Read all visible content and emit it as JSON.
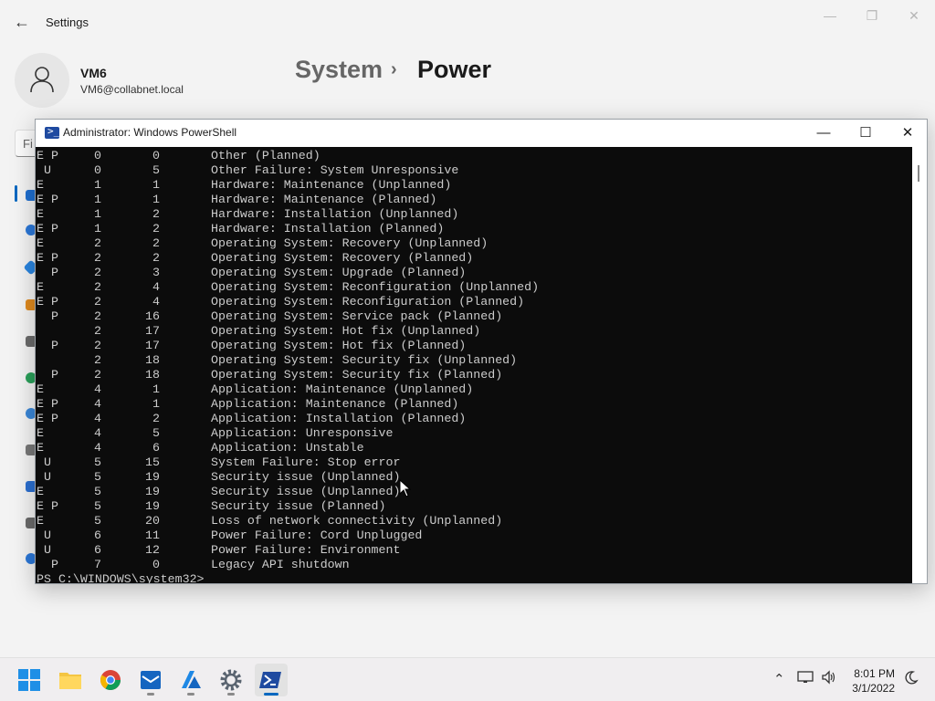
{
  "settings": {
    "app_title": "Settings",
    "user_name": "VM6",
    "user_email": "VM6@collabnet.local",
    "breadcrumb_parent": "System",
    "breadcrumb_separator": "›",
    "breadcrumb_current": "Power",
    "search_placeholder": "Fi"
  },
  "powershell": {
    "title": "Administrator: Windows PowerShell",
    "rows": [
      {
        "flags": "E P",
        "major": "0",
        "minor": "0",
        "desc": "Other (Planned)"
      },
      {
        "flags": " U",
        "major": "0",
        "minor": "5",
        "desc": "Other Failure: System Unresponsive"
      },
      {
        "flags": "E",
        "major": "1",
        "minor": "1",
        "desc": "Hardware: Maintenance (Unplanned)"
      },
      {
        "flags": "E P",
        "major": "1",
        "minor": "1",
        "desc": "Hardware: Maintenance (Planned)"
      },
      {
        "flags": "E",
        "major": "1",
        "minor": "2",
        "desc": "Hardware: Installation (Unplanned)"
      },
      {
        "flags": "E P",
        "major": "1",
        "minor": "2",
        "desc": "Hardware: Installation (Planned)"
      },
      {
        "flags": "E",
        "major": "2",
        "minor": "2",
        "desc": "Operating System: Recovery (Unplanned)"
      },
      {
        "flags": "E P",
        "major": "2",
        "minor": "2",
        "desc": "Operating System: Recovery (Planned)"
      },
      {
        "flags": "  P",
        "major": "2",
        "minor": "3",
        "desc": "Operating System: Upgrade (Planned)"
      },
      {
        "flags": "E",
        "major": "2",
        "minor": "4",
        "desc": "Operating System: Reconfiguration (Unplanned)"
      },
      {
        "flags": "E P",
        "major": "2",
        "minor": "4",
        "desc": "Operating System: Reconfiguration (Planned)"
      },
      {
        "flags": "  P",
        "major": "2",
        "minor": "16",
        "desc": "Operating System: Service pack (Planned)"
      },
      {
        "flags": "",
        "major": "2",
        "minor": "17",
        "desc": "Operating System: Hot fix (Unplanned)"
      },
      {
        "flags": "  P",
        "major": "2",
        "minor": "17",
        "desc": "Operating System: Hot fix (Planned)"
      },
      {
        "flags": "",
        "major": "2",
        "minor": "18",
        "desc": "Operating System: Security fix (Unplanned)"
      },
      {
        "flags": "  P",
        "major": "2",
        "minor": "18",
        "desc": "Operating System: Security fix (Planned)"
      },
      {
        "flags": "E",
        "major": "4",
        "minor": "1",
        "desc": "Application: Maintenance (Unplanned)"
      },
      {
        "flags": "E P",
        "major": "4",
        "minor": "1",
        "desc": "Application: Maintenance (Planned)"
      },
      {
        "flags": "E P",
        "major": "4",
        "minor": "2",
        "desc": "Application: Installation (Planned)"
      },
      {
        "flags": "E",
        "major": "4",
        "minor": "5",
        "desc": "Application: Unresponsive"
      },
      {
        "flags": "E",
        "major": "4",
        "minor": "6",
        "desc": "Application: Unstable"
      },
      {
        "flags": " U",
        "major": "5",
        "minor": "15",
        "desc": "System Failure: Stop error"
      },
      {
        "flags": " U",
        "major": "5",
        "minor": "19",
        "desc": "Security issue (Unplanned)"
      },
      {
        "flags": "E",
        "major": "5",
        "minor": "19",
        "desc": "Security issue (Unplanned)"
      },
      {
        "flags": "E P",
        "major": "5",
        "minor": "19",
        "desc": "Security issue (Planned)"
      },
      {
        "flags": "E",
        "major": "5",
        "minor": "20",
        "desc": "Loss of network connectivity (Unplanned)"
      },
      {
        "flags": " U",
        "major": "6",
        "minor": "11",
        "desc": "Power Failure: Cord Unplugged"
      },
      {
        "flags": " U",
        "major": "6",
        "minor": "12",
        "desc": "Power Failure: Environment"
      },
      {
        "flags": "  P",
        "major": "7",
        "minor": "0",
        "desc": "Legacy API shutdown"
      }
    ],
    "prompt": "PS C:\\WINDOWS\\system32>"
  },
  "taskbar": {
    "time": "8:01 PM",
    "date": "3/1/2022",
    "apps": [
      "start-icon",
      "file-explorer-icon",
      "chrome-icon",
      "mail-app-icon",
      "azure-icon",
      "settings-icon",
      "powershell-icon"
    ]
  },
  "colors": {
    "console_bg": "#0c0c0c",
    "console_text": "#cccccc",
    "accent": "#0067c0"
  }
}
